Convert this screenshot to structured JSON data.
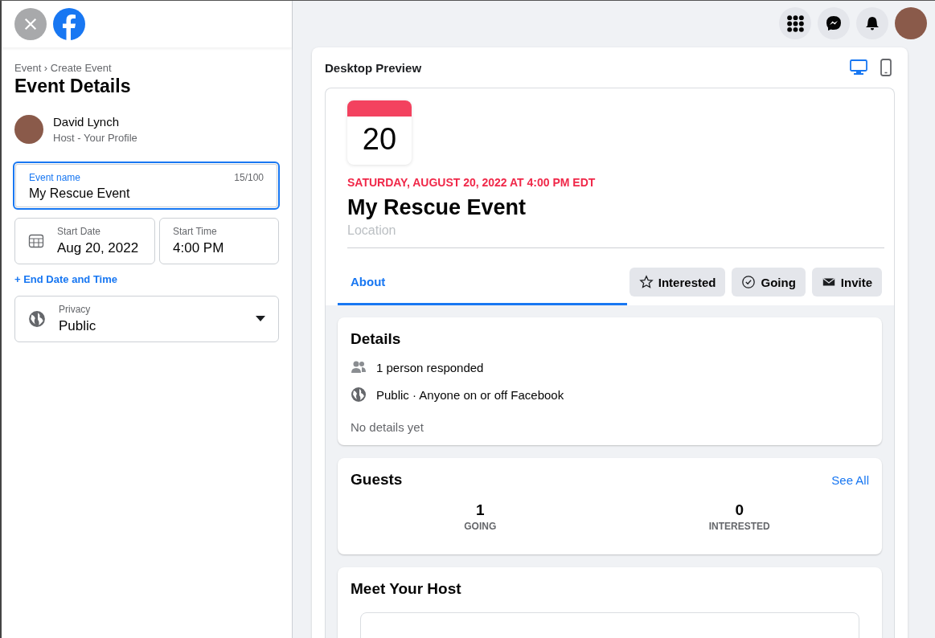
{
  "sidebar": {
    "breadcrumb": "Event › Create Event",
    "title": "Event Details",
    "host": {
      "name": "David Lynch",
      "role": "Host - Your Profile"
    },
    "event_name": {
      "label": "Event name",
      "value": "My Rescue Event",
      "counter": "15/100",
      "focused": true
    },
    "start_date": {
      "label": "Start Date",
      "value": "Aug 20, 2022"
    },
    "start_time": {
      "label": "Start Time",
      "value": "4:00 PM"
    },
    "end_link": "+ End Date and Time",
    "privacy": {
      "label": "Privacy",
      "value": "Public"
    }
  },
  "preview": {
    "title": "Desktop Preview",
    "devices": [
      {
        "kind": "desktop",
        "selected": true
      },
      {
        "kind": "mobile",
        "selected": false
      }
    ],
    "event": {
      "day": "20",
      "datetime": "SATURDAY, AUGUST 20, 2022 AT 4:00 PM EDT",
      "name": "My Rescue Event",
      "location": "Location",
      "tabs": [
        {
          "label": "About",
          "selected": true
        }
      ],
      "actions": [
        {
          "kind": "star",
          "label": "Interested"
        },
        {
          "kind": "check",
          "label": "Going"
        },
        {
          "kind": "mail",
          "label": "Invite"
        }
      ]
    },
    "details": {
      "title": "Details",
      "rows": [
        {
          "kind": "people",
          "text": "1 person responded"
        },
        {
          "kind": "globe",
          "text": "Public · Anyone on or off Facebook"
        }
      ],
      "note": "No details yet"
    },
    "guests": {
      "title": "Guests",
      "link": "See All",
      "stats": [
        {
          "count": "1",
          "label": "GOING"
        },
        {
          "count": "0",
          "label": "INTERESTED"
        }
      ]
    },
    "host_card": {
      "title": "Meet Your Host"
    }
  }
}
